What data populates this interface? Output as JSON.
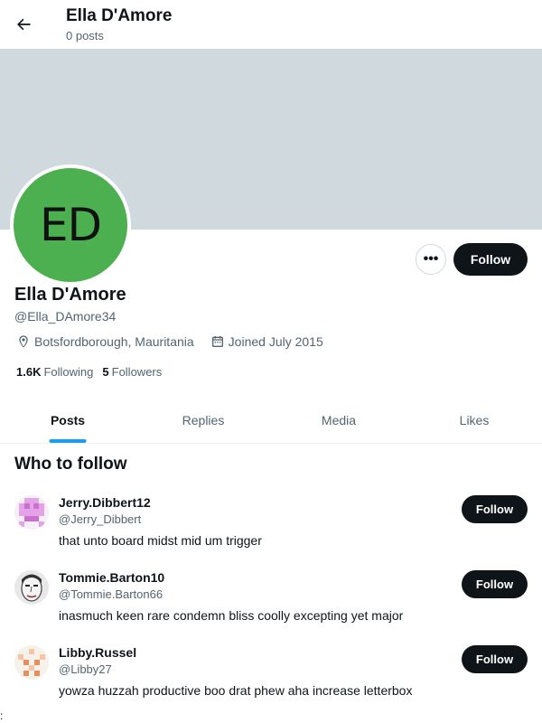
{
  "header": {
    "title": "Ella D'Amore",
    "subtitle": "0 posts",
    "back_icon": "arrow-left-icon"
  },
  "profile": {
    "avatar_initials": "ED",
    "avatar_color": "#4caf50",
    "banner_color": "#cfd9de",
    "name": "Ella D'Amore",
    "handle": "@Ella_DAmore34",
    "location": "Botsfordborough, Mauritania",
    "joined": "Joined July 2015",
    "following_count": "1.6K",
    "following_label": "Following",
    "followers_count": "5",
    "followers_label": "Followers",
    "more_label": "•••",
    "follow_label": "Follow"
  },
  "tabs": [
    {
      "label": "Posts",
      "active": true
    },
    {
      "label": "Replies",
      "active": false
    },
    {
      "label": "Media",
      "active": false
    },
    {
      "label": "Likes",
      "active": false
    }
  ],
  "who_to_follow": {
    "title": "Who to follow",
    "items": [
      {
        "name": "Jerry.Dibbert12",
        "handle": "@Jerry_Dibbert",
        "bio": "that unto board midst mid um trigger",
        "follow_label": "Follow",
        "avatar_icon": "pink-pixel-avatar"
      },
      {
        "name": "Tommie.Barton10",
        "handle": "@Tommie.Barton66",
        "bio": "inasmuch keen rare condemn bliss coolly excepting yet major",
        "follow_label": "Follow",
        "avatar_icon": "face-sketch-avatar"
      },
      {
        "name": "Libby.Russel",
        "handle": "@Libby27",
        "bio": "yowza huzzah productive boo drat phew aha increase letterbox",
        "follow_label": "Follow",
        "avatar_icon": "orange-pixel-avatar"
      }
    ]
  },
  "stray_text": ":",
  "colors": {
    "accent": "#1d9bf0",
    "button_dark": "#0f1419",
    "secondary_text": "#536471"
  }
}
